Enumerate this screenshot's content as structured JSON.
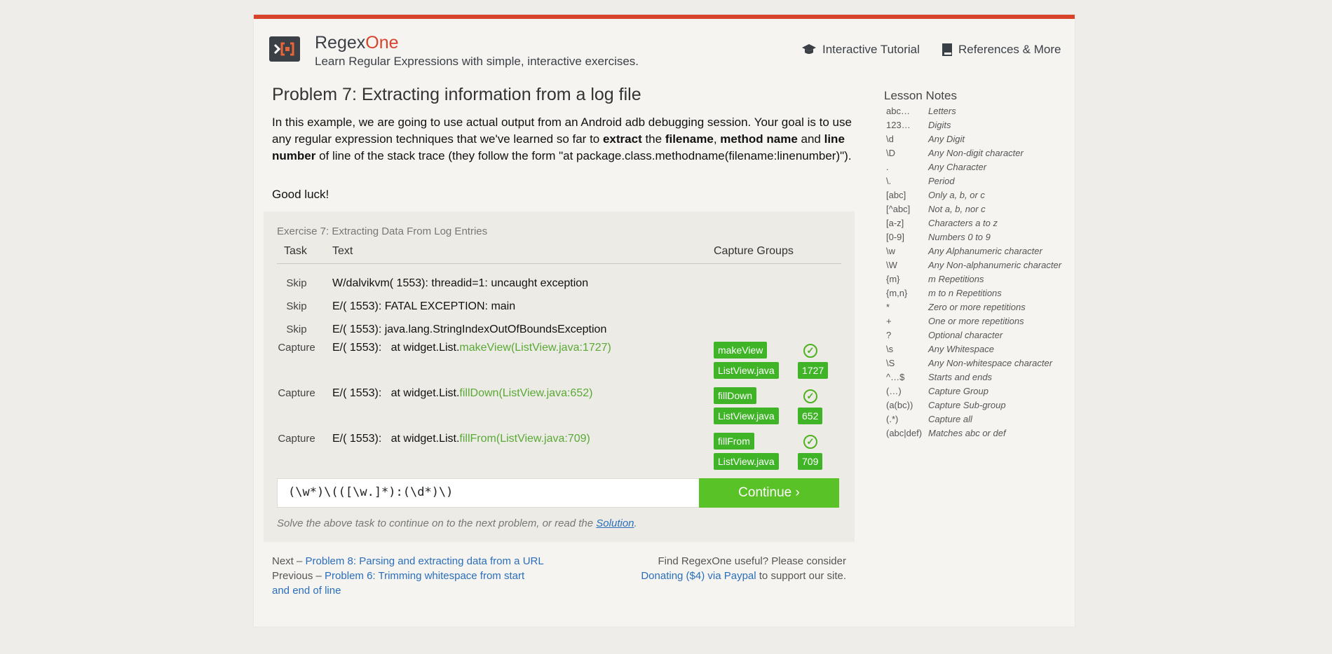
{
  "header": {
    "brand_prefix": "Regex",
    "brand_suffix": "One",
    "tagline": "Learn Regular Expressions with simple, interactive exercises.",
    "nav": [
      {
        "label": "Interactive Tutorial",
        "icon": "graduation-cap-icon"
      },
      {
        "label": "References & More",
        "icon": "book-icon"
      }
    ]
  },
  "lesson": {
    "title": "Problem 7: Extracting information from a log file",
    "intro": {
      "p1": "In this example, we are going to use actual output from an Android adb debugging session. Your goal is to use any regular expression techniques that we've learned so far to ",
      "b1": "extract",
      "p2": " the ",
      "b2": "filename",
      "p3": ", ",
      "b3": "method name",
      "p4": " and ",
      "b4": "line number",
      "p5": " of line of the stack trace (they follow the form \"at package.class.methodname(filename:linenumber)\")."
    },
    "good_luck": "Good luck!"
  },
  "exercise": {
    "title": "Exercise 7: Extracting Data From Log Entries",
    "columns": {
      "task": "Task",
      "text": "Text",
      "groups": "Capture Groups"
    },
    "rows": [
      {
        "task": "Skip",
        "prefix": "W/dalvikvm( 1553): threadid=1: uncaught exception",
        "match": "",
        "groups": []
      },
      {
        "task": "Skip",
        "prefix": "E/( 1553): FATAL EXCEPTION: main",
        "match": "",
        "groups": []
      },
      {
        "task": "Skip",
        "prefix": "E/( 1553): java.lang.StringIndexOutOfBoundsException",
        "match": "",
        "groups": []
      },
      {
        "task": "Capture",
        "prefix": "E/( 1553):   at widget.List.",
        "match": "makeView(ListView.java:1727)",
        "groups": [
          "makeView",
          "ListView.java",
          "1727"
        ]
      },
      {
        "task": "Capture",
        "prefix": "E/( 1553):   at widget.List.",
        "match": "fillDown(ListView.java:652)",
        "groups": [
          "fillDown",
          "ListView.java",
          "652"
        ]
      },
      {
        "task": "Capture",
        "prefix": "E/( 1553):   at widget.List.",
        "match": "fillFrom(ListView.java:709)",
        "groups": [
          "fillFrom",
          "ListView.java",
          "709"
        ]
      }
    ],
    "input_value": "(\\w*)\\(([\\w.]*):(\\d*)\\)",
    "continue_label": "Continue ›",
    "hint_text": "Solve the above task to continue on to the next problem, or read the ",
    "hint_link": "Solution",
    "hint_end": "."
  },
  "footer": {
    "next_prefix": "Next – ",
    "next_link": "Problem 8: Parsing and extracting data from a URL",
    "prev_prefix": "Previous – ",
    "prev_link": "Problem 6: Trimming whitespace from start and end of line",
    "donate_text": "Find RegexOne useful? Please consider",
    "donate_link": "Donating ($4) via Paypal",
    "donate_end": " to support our site."
  },
  "notes": {
    "title": "Lesson Notes",
    "items": [
      {
        "sym": "abc…",
        "desc": "Letters"
      },
      {
        "sym": "123…",
        "desc": "Digits"
      },
      {
        "sym": "\\d",
        "desc": "Any Digit"
      },
      {
        "sym": "\\D",
        "desc": "Any Non-digit character"
      },
      {
        "sym": ".",
        "desc": "Any Character"
      },
      {
        "sym": "\\.",
        "desc": "Period"
      },
      {
        "sym": "[abc]",
        "desc": "Only a, b, or c"
      },
      {
        "sym": "[^abc]",
        "desc": "Not a, b, nor c"
      },
      {
        "sym": "[a-z]",
        "desc": "Characters a to z"
      },
      {
        "sym": "[0-9]",
        "desc": "Numbers 0 to 9"
      },
      {
        "sym": "\\w",
        "desc": "Any Alphanumeric character"
      },
      {
        "sym": "\\W",
        "desc": "Any Non-alphanumeric character"
      },
      {
        "sym": "{m}",
        "desc": "m Repetitions"
      },
      {
        "sym": "{m,n}",
        "desc": "m to n Repetitions"
      },
      {
        "sym": "*",
        "desc": "Zero or more repetitions"
      },
      {
        "sym": "+",
        "desc": "One or more repetitions"
      },
      {
        "sym": "?",
        "desc": "Optional character"
      },
      {
        "sym": "\\s",
        "desc": "Any Whitespace"
      },
      {
        "sym": "\\S",
        "desc": "Any Non-whitespace character"
      },
      {
        "sym": "^…$",
        "desc": "Starts and ends"
      },
      {
        "sym": "(…)",
        "desc": "Capture Group"
      },
      {
        "sym": "(a(bc))",
        "desc": "Capture Sub-group"
      },
      {
        "sym": "(.*)",
        "desc": "Capture all"
      },
      {
        "sym": "(abc|def)",
        "desc": "Matches abc or def"
      }
    ]
  },
  "colors": {
    "accent": "#d8432c",
    "match": "#5aa935",
    "group_bg": "#3fb427",
    "continue_bg": "#58c226",
    "link": "#2a6ebb"
  }
}
